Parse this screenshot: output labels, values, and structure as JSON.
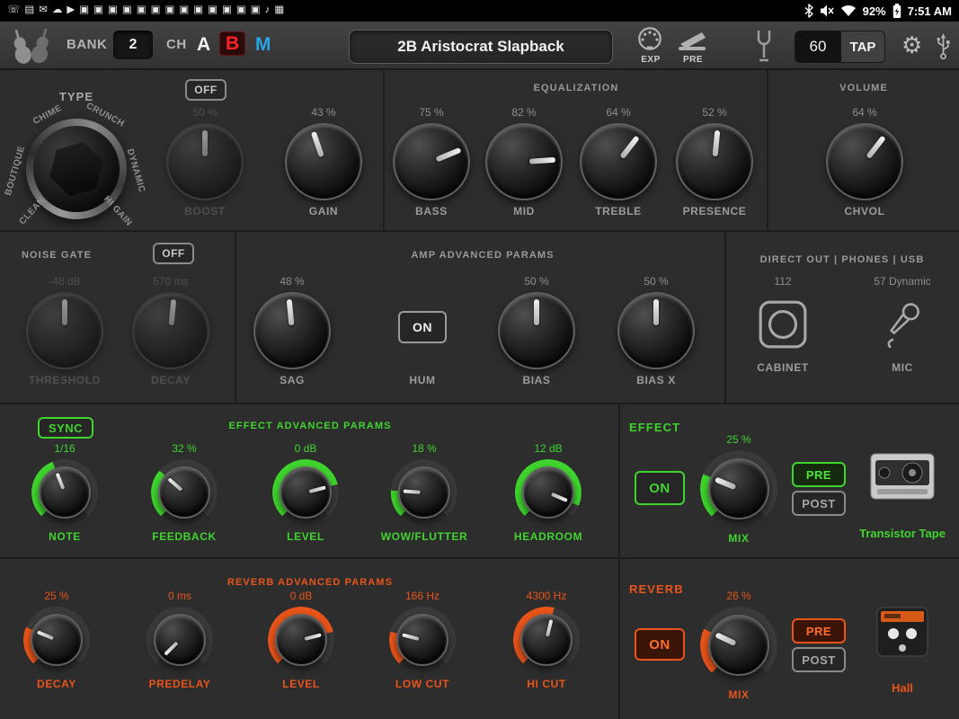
{
  "status_bar": {
    "time": "7:51 AM",
    "battery": "92%",
    "left_icons": [
      {
        "name": "phone-icon",
        "glyph": "☏"
      },
      {
        "name": "gallery-icon",
        "glyph": "▤"
      },
      {
        "name": "email-icon",
        "glyph": "✉"
      },
      {
        "name": "cloud-icon",
        "glyph": "☁"
      },
      {
        "name": "play-icon",
        "glyph": "▶"
      },
      {
        "name": "gamepad-icon",
        "glyph": "▣"
      },
      {
        "name": "gamepad-icon",
        "glyph": "▣"
      },
      {
        "name": "gamepad-icon",
        "glyph": "▣"
      },
      {
        "name": "gamepad-icon",
        "glyph": "▣"
      },
      {
        "name": "gamepad-icon",
        "glyph": "▣"
      },
      {
        "name": "gamepad-icon",
        "glyph": "▣"
      },
      {
        "name": "gamepad-icon",
        "glyph": "▣"
      },
      {
        "name": "gamepad-icon",
        "glyph": "▣"
      },
      {
        "name": "gamepad-icon",
        "glyph": "▣"
      },
      {
        "name": "gamepad-icon",
        "glyph": "▣"
      },
      {
        "name": "gamepad-icon",
        "glyph": "▣"
      },
      {
        "name": "gamepad-icon",
        "glyph": "▣"
      },
      {
        "name": "gamepad-icon",
        "glyph": "▣"
      },
      {
        "name": "music-icon",
        "glyph": "♪"
      },
      {
        "name": "apps-icon",
        "glyph": "▦"
      }
    ]
  },
  "header": {
    "bank_label": "BANK",
    "bank_value": "2",
    "channel_label": "CH",
    "channel_a": "A",
    "channel_b": "B",
    "channel_m": "M",
    "preset_name": "2B Aristocrat Slapback",
    "exp_label": "EXP",
    "pre_label": "PRE",
    "tempo_value": "60",
    "tap_label": "TAP"
  },
  "type_section": {
    "title": "TYPE",
    "off_button": "OFF",
    "dial_labels": [
      "CLEAN",
      "BOUTIQUE",
      "CHIME",
      "CRUNCH",
      "DYNAMIC",
      "HI GAIN"
    ],
    "boost": {
      "value": "50 %",
      "label": "BOOST",
      "pct": 50,
      "state": "disabled"
    },
    "gain": {
      "value": "43 %",
      "label": "GAIN",
      "pct": 43
    }
  },
  "equalization": {
    "title": "EQUALIZATION",
    "knobs": [
      {
        "value": "75 %",
        "label": "BASS",
        "pct": 75
      },
      {
        "value": "82 %",
        "label": "MID",
        "pct": 82
      },
      {
        "value": "64 %",
        "label": "TREBLE",
        "pct": 64
      },
      {
        "value": "52 %",
        "label": "PRESENCE",
        "pct": 52
      }
    ]
  },
  "volume": {
    "title": "VOLUME",
    "chvol": {
      "value": "64 %",
      "label": "CHVOL",
      "pct": 64
    }
  },
  "noise_gate": {
    "title": "NOISE GATE",
    "off_button": "OFF",
    "threshold": {
      "value": "-48 dB",
      "label": "THRESHOLD",
      "pct": 50,
      "state": "disabled"
    },
    "decay": {
      "value": "570 ms",
      "label": "DECAY",
      "pct": 52,
      "state": "disabled"
    }
  },
  "amp_advanced": {
    "title": "AMP ADVANCED PARAMS",
    "sag": {
      "value": "48 %",
      "label": "SAG",
      "pct": 48
    },
    "hum": {
      "button": "ON",
      "label": "HUM"
    },
    "bias": {
      "value": "50 %",
      "label": "BIAS",
      "pct": 50
    },
    "bias_x": {
      "value": "50 %",
      "label": "BIAS X",
      "pct": 50
    }
  },
  "direct_out": {
    "title": "DIRECT OUT | PHONES | USB",
    "cabinet": {
      "value": "112",
      "label": "CABINET"
    },
    "mic": {
      "value": "57 Dynamic",
      "label": "MIC"
    }
  },
  "effect_advanced": {
    "title": "EFFECT ADVANCED PARAMS",
    "sync_button": "SYNC",
    "knobs": [
      {
        "value": "1/16",
        "label": "NOTE",
        "pct": 42,
        "accent": "green"
      },
      {
        "value": "32 %",
        "label": "FEEDBACK",
        "pct": 32,
        "accent": "green"
      },
      {
        "value": "0 dB",
        "label": "LEVEL",
        "pct": 78,
        "accent": "green"
      },
      {
        "value": "18 %",
        "label": "WOW/FLUTTER",
        "pct": 18,
        "accent": "green"
      },
      {
        "value": "12 dB",
        "label": "HEADROOM",
        "pct": 92,
        "accent": "green"
      }
    ]
  },
  "effect_panel": {
    "title": "EFFECT",
    "on_button": "ON",
    "mix": {
      "value": "25 %",
      "label": "MIX",
      "pct": 25,
      "accent": "green"
    },
    "pre_button": "PRE",
    "post_button": "POST",
    "model_name": "Transistor Tape"
  },
  "reverb_advanced": {
    "title": "REVERB ADVANCED PARAMS",
    "knobs": [
      {
        "value": "25 %",
        "label": "DECAY",
        "pct": 25,
        "accent": "orange"
      },
      {
        "value": "0 ms",
        "label": "PREDELAY",
        "pct": 0,
        "accent": "orange"
      },
      {
        "value": "0 dB",
        "label": "LEVEL",
        "pct": 78,
        "accent": "orange"
      },
      {
        "value": "166 Hz",
        "label": "LOW CUT",
        "pct": 22,
        "accent": "orange"
      },
      {
        "value": "4300 Hz",
        "label": "HI CUT",
        "pct": 55,
        "accent": "orange"
      }
    ]
  },
  "reverb_panel": {
    "title": "REVERB",
    "on_button": "ON",
    "mix": {
      "value": "26 %",
      "label": "MIX",
      "pct": 26,
      "accent": "orange"
    },
    "pre_button": "PRE",
    "post_button": "POST",
    "model_name": "Hall"
  },
  "colors": {
    "green": "#3fd42e",
    "orange": "#e8541a",
    "red": "#ff2222",
    "blue": "#2aa6e8"
  }
}
